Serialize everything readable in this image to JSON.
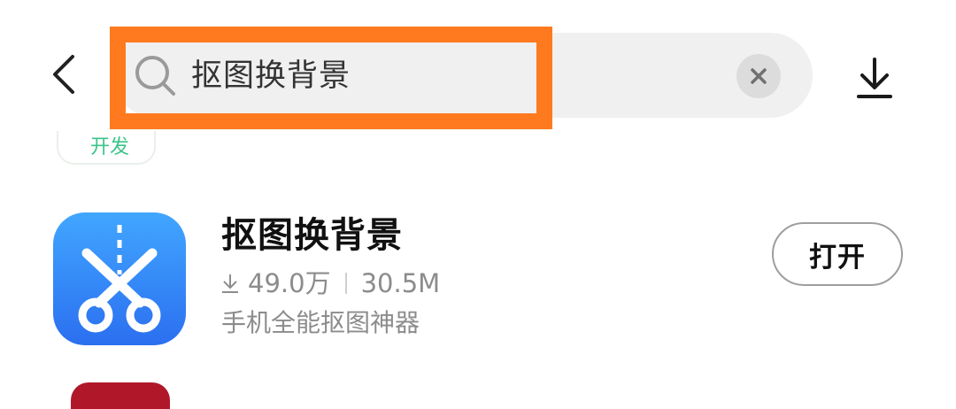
{
  "header": {
    "back_icon": "chevron-left-icon",
    "search": {
      "query": "抠图换背景",
      "search_icon": "search-icon",
      "clear_icon": "close-icon"
    },
    "download_icon": "download-icon",
    "highlight_color": "#ff7a1f"
  },
  "partial_card": {
    "text": "开发"
  },
  "result": {
    "app_name": "抠图换背景",
    "downloads": "49.0万",
    "size": "30.5M",
    "description": "手机全能抠图神器",
    "action_label": "打开",
    "icon": "scissors-icon",
    "icon_colors": [
      "#41a6ff",
      "#2b6ff0"
    ]
  }
}
